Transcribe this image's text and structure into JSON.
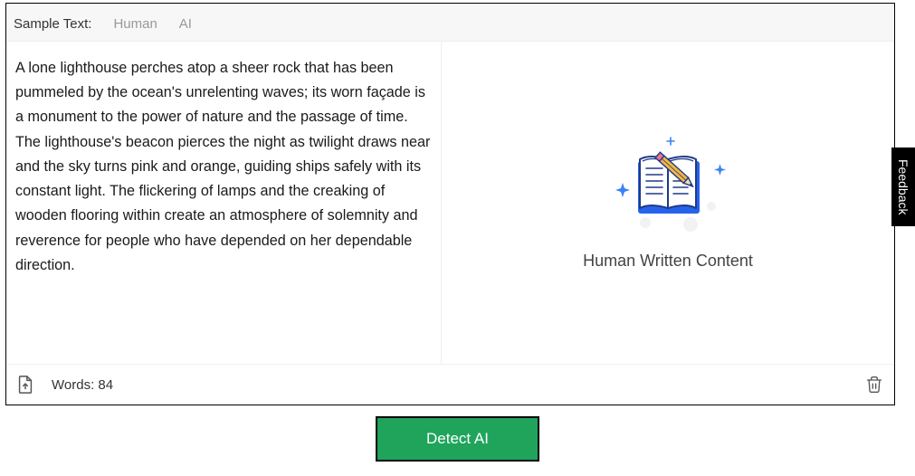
{
  "tabs": {
    "label": "Sample Text:",
    "human": "Human",
    "ai": "AI"
  },
  "sampleText": "A lone lighthouse perches atop a sheer rock that has been pummeled by the ocean's unrelenting waves; its worn façade is a monument to the power of nature and the passage of time. The lighthouse's beacon pierces the night as twilight draws near and the sky turns pink and orange, guiding ships safely with its constant light. The flickering of lamps and the creaking of wooden flooring within create an atmosphere of solemnity and reverence for people who have depended on her dependable direction.",
  "result": {
    "caption": "Human Written Content"
  },
  "footer": {
    "wordCount": "Words: 84"
  },
  "detectButton": "Detect AI",
  "feedback": "Feedback"
}
